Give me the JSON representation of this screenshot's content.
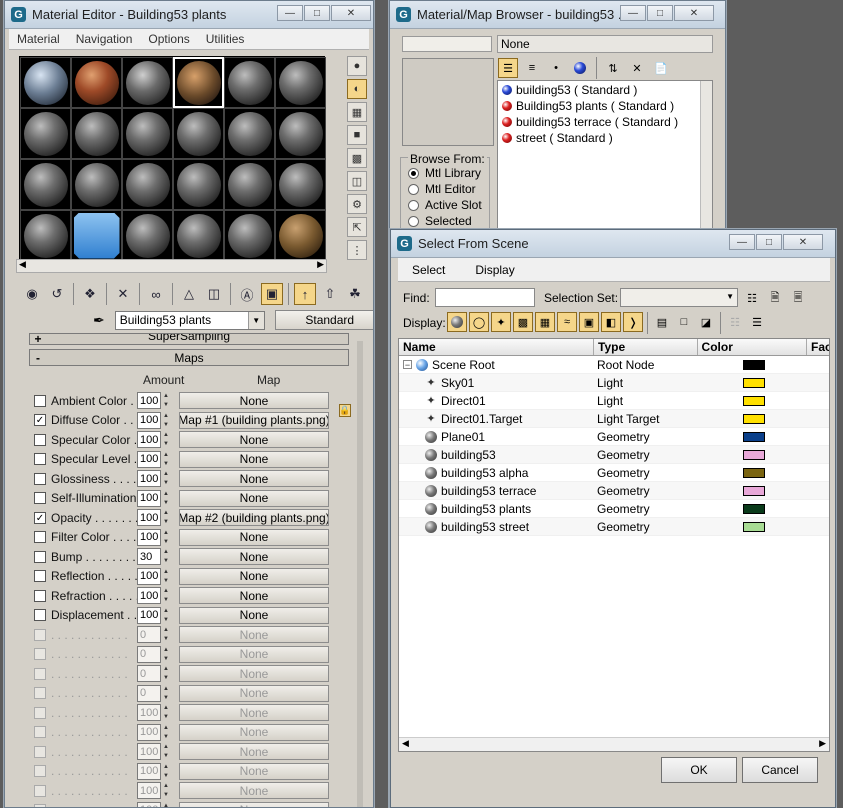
{
  "material_editor": {
    "title": "Material Editor - Building53 plants",
    "menu": [
      "Material",
      "Navigation",
      "Options",
      "Utilities"
    ],
    "material_name": "Building53 plants",
    "material_type": "Standard",
    "rollup_supersampling": "SuperSampling",
    "rollup_maps": "Maps",
    "supersampling_sign": "+",
    "maps_sign": "-",
    "header_amount": "Amount",
    "header_map": "Map",
    "maps": [
      {
        "label": "Ambient Color . . .",
        "checked": false,
        "amount": "100",
        "map": "None",
        "enabled": true
      },
      {
        "label": "Diffuse Color . . .",
        "checked": true,
        "amount": "100",
        "map": "Map #1 (building plants.png)",
        "enabled": true
      },
      {
        "label": "Specular Color . .",
        "checked": false,
        "amount": "100",
        "map": "None",
        "enabled": true
      },
      {
        "label": "Specular Level . .",
        "checked": false,
        "amount": "100",
        "map": "None",
        "enabled": true
      },
      {
        "label": "Glossiness . . . . .",
        "checked": false,
        "amount": "100",
        "map": "None",
        "enabled": true
      },
      {
        "label": "Self-Illumination .",
        "checked": false,
        "amount": "100",
        "map": "None",
        "enabled": true
      },
      {
        "label": "Opacity . . . . . . .",
        "checked": true,
        "amount": "100",
        "map": "Map #2 (building plants.png)",
        "enabled": true
      },
      {
        "label": "Filter Color . . . .",
        "checked": false,
        "amount": "100",
        "map": "None",
        "enabled": true
      },
      {
        "label": "Bump . . . . . . . .",
        "checked": false,
        "amount": "30",
        "map": "None",
        "enabled": true
      },
      {
        "label": "Reflection . . . . .",
        "checked": false,
        "amount": "100",
        "map": "None",
        "enabled": true
      },
      {
        "label": "Refraction . . . . .",
        "checked": false,
        "amount": "100",
        "map": "None",
        "enabled": true
      },
      {
        "label": "Displacement . . .",
        "checked": false,
        "amount": "100",
        "map": "None",
        "enabled": true
      },
      {
        "label": ". . . . . . . . . . . .",
        "checked": false,
        "amount": "0",
        "map": "None",
        "enabled": false
      },
      {
        "label": ". . . . . . . . . . . .",
        "checked": false,
        "amount": "0",
        "map": "None",
        "enabled": false
      },
      {
        "label": ". . . . . . . . . . . .",
        "checked": false,
        "amount": "0",
        "map": "None",
        "enabled": false
      },
      {
        "label": ". . . . . . . . . . . .",
        "checked": false,
        "amount": "0",
        "map": "None",
        "enabled": false
      },
      {
        "label": ". . . . . . . . . . . .",
        "checked": false,
        "amount": "100",
        "map": "None",
        "enabled": false
      },
      {
        "label": ". . . . . . . . . . . .",
        "checked": false,
        "amount": "100",
        "map": "None",
        "enabled": false
      },
      {
        "label": ". . . . . . . . . . . .",
        "checked": false,
        "amount": "100",
        "map": "None",
        "enabled": false
      },
      {
        "label": ". . . . . . . . . . . .",
        "checked": false,
        "amount": "100",
        "map": "None",
        "enabled": false
      },
      {
        "label": ". . . . . . . . . . . .",
        "checked": false,
        "amount": "100",
        "map": "None",
        "enabled": false
      },
      {
        "label": ". . . . . . . . . . . .",
        "checked": false,
        "amount": "100",
        "map": "None",
        "enabled": false
      }
    ]
  },
  "browser": {
    "title": "Material/Map Browser - building53 ...",
    "name_field": "None",
    "browse_from_label": "Browse From:",
    "browse_options": [
      {
        "label": "Mtl Library",
        "selected": true
      },
      {
        "label": "Mtl Editor",
        "selected": false
      },
      {
        "label": "Active Slot",
        "selected": false
      },
      {
        "label": "Selected",
        "selected": false
      }
    ],
    "materials": [
      {
        "label": "building53  ( Standard )",
        "color": "blue"
      },
      {
        "label": "Building53 plants  ( Standard )",
        "color": "red"
      },
      {
        "label": "building53 terrace  ( Standard )",
        "color": "red"
      },
      {
        "label": "street  ( Standard )",
        "color": "red"
      }
    ]
  },
  "select_scene": {
    "title": "Select From Scene",
    "menu": [
      "Select",
      "Display"
    ],
    "find_label": "Find:",
    "find_value": "",
    "selection_set_label": "Selection Set:",
    "display_label": "Display:",
    "columns": [
      "Name",
      "Type",
      "Color",
      "Fac"
    ],
    "rows": [
      {
        "name": "Scene Root",
        "type": "Root Node",
        "color": "#000000",
        "icon": "root",
        "indent": 0
      },
      {
        "name": "Sky01",
        "type": "Light",
        "color": "#ffe000",
        "icon": "light",
        "indent": 1
      },
      {
        "name": "Direct01",
        "type": "Light",
        "color": "#ffe000",
        "icon": "light",
        "indent": 1
      },
      {
        "name": "Direct01.Target",
        "type": "Light Target",
        "color": "#ffe000",
        "icon": "light",
        "indent": 1
      },
      {
        "name": "Plane01",
        "type": "Geometry",
        "color": "#0a3f8a",
        "icon": "geo",
        "indent": 1
      },
      {
        "name": "building53",
        "type": "Geometry",
        "color": "#e8a8d8",
        "icon": "geo",
        "indent": 1
      },
      {
        "name": "building53 alpha",
        "type": "Geometry",
        "color": "#7a6410",
        "icon": "geo",
        "indent": 1
      },
      {
        "name": "building53 terrace",
        "type": "Geometry",
        "color": "#e8a8d8",
        "icon": "geo",
        "indent": 1
      },
      {
        "name": "building53 plants",
        "type": "Geometry",
        "color": "#0a3a1a",
        "icon": "geo",
        "indent": 1
      },
      {
        "name": "building53 street",
        "type": "Geometry",
        "color": "#a8dc94",
        "icon": "geo",
        "indent": 1
      }
    ],
    "ok_label": "OK",
    "cancel_label": "Cancel"
  }
}
